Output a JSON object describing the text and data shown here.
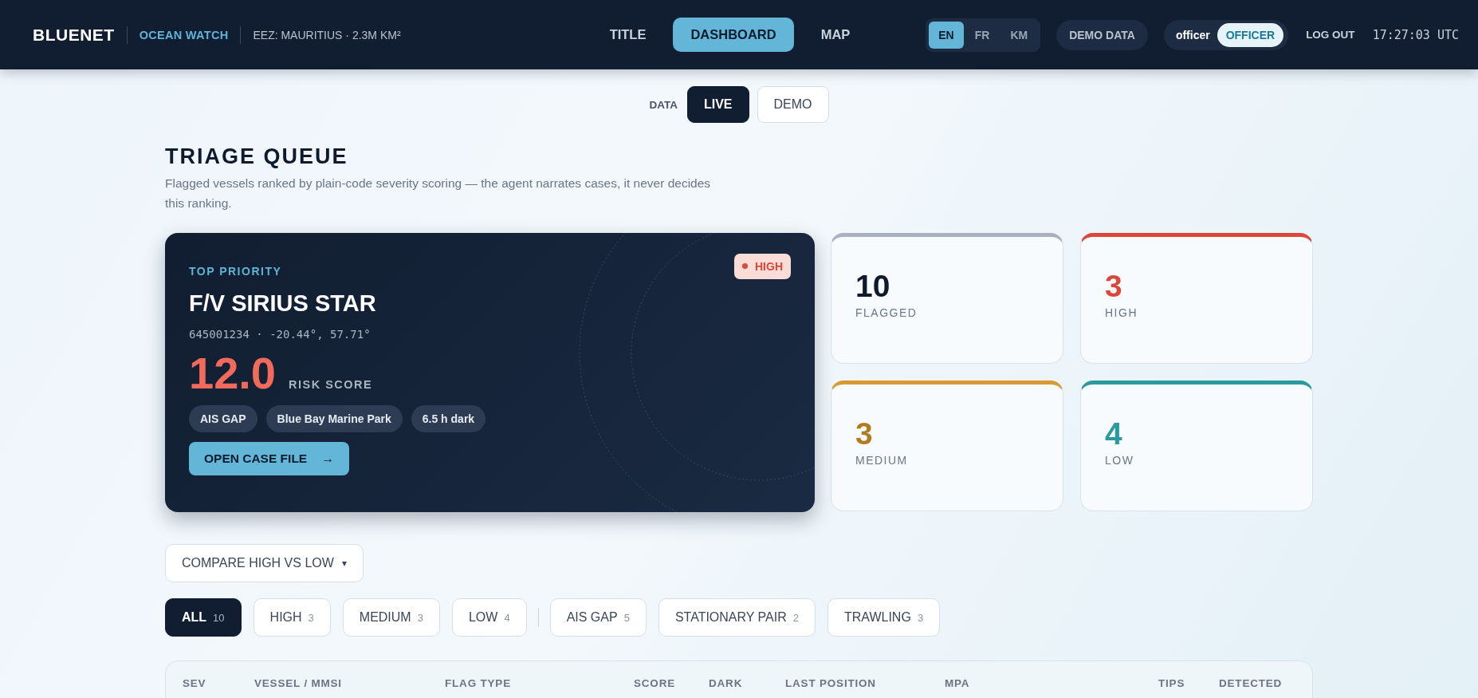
{
  "header": {
    "logo": "BLUENET",
    "product": "OCEAN WATCH",
    "region": "EEZ: MAURITIUS · 2.3M KM²",
    "nav": [
      {
        "label": "TITLE",
        "selected": false
      },
      {
        "label": "DASHBOARD",
        "selected": true
      },
      {
        "label": "MAP",
        "selected": false
      }
    ],
    "languages": [
      {
        "label": "EN",
        "selected": true
      },
      {
        "label": "FR",
        "selected": false
      },
      {
        "label": "KM",
        "selected": false
      }
    ],
    "demo_data": "DEMO DATA",
    "user": "officer",
    "role": "OFFICER",
    "role_active": true,
    "logout": "LOG OUT",
    "clock": "17:27:03 UTC"
  },
  "data_toggle": {
    "label": "DATA",
    "options": [
      {
        "label": "LIVE",
        "selected": true
      },
      {
        "label": "DEMO",
        "selected": false
      }
    ]
  },
  "title": "TRIAGE QUEUE",
  "subtitle": "Flagged vessels ranked by plain-code severity scoring — the agent narrates cases, it never decides this ranking.",
  "top_case": {
    "eyebrow": "TOP PRIORITY",
    "severity": "HIGH",
    "vessel": "F/V SIRIUS STAR",
    "meta": "645001234 · -20.44°, 57.71°",
    "score": "12.0",
    "score_label": "RISK SCORE",
    "tags": [
      "AIS GAP",
      "Blue Bay Marine Park",
      "6.5 h dark"
    ],
    "button": "OPEN CASE FILE",
    "button_arrow": "→"
  },
  "stats": [
    {
      "value": "10",
      "label": "FLAGGED",
      "color": "#a9b1be"
    },
    {
      "value": "3",
      "label": "HIGH",
      "color": "#d9483b"
    },
    {
      "value": "3",
      "label": "MEDIUM",
      "color": "#d99a35"
    },
    {
      "value": "4",
      "label": "LOW",
      "color": "#2a9a9c"
    }
  ],
  "compare": {
    "label": "COMPARE HIGH VS LOW",
    "caret": "▾"
  },
  "severity_filters": [
    {
      "label": "ALL",
      "count": "10",
      "selected": true
    },
    {
      "label": "HIGH",
      "count": "3",
      "selected": false
    },
    {
      "label": "MEDIUM",
      "count": "3",
      "selected": false
    },
    {
      "label": "LOW",
      "count": "4",
      "selected": false
    }
  ],
  "type_filters": [
    {
      "label": "AIS GAP",
      "count": "5",
      "selected": false
    },
    {
      "label": "STATIONARY PAIR",
      "count": "2",
      "selected": false
    },
    {
      "label": "TRAWLING",
      "count": "3",
      "selected": false
    }
  ],
  "table": {
    "columns": [
      "SEV",
      "VESSEL / MMSI",
      "FLAG TYPE",
      "SCORE",
      "DARK",
      "LAST POSITION",
      "MPA",
      "TIPS",
      "DETECTED"
    ]
  }
}
